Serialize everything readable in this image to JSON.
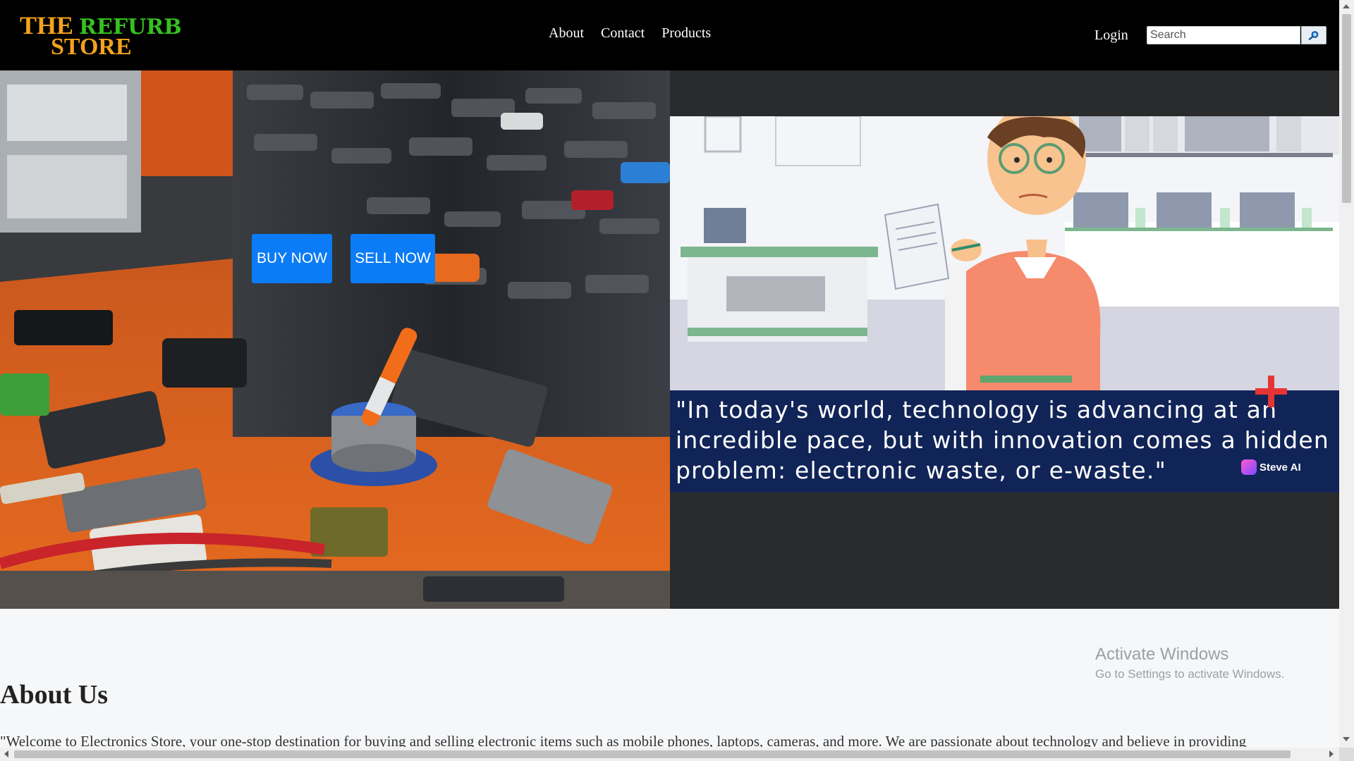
{
  "logo": {
    "line1_a": "THE",
    "line1_b": "REFURB",
    "line2": "STORE"
  },
  "nav": {
    "items": [
      "About",
      "Contact",
      "Products"
    ]
  },
  "header": {
    "login_label": "Login",
    "search_placeholder": "Search",
    "search_icon": "search-icon"
  },
  "hero": {
    "buy_label": "BUY NOW",
    "sell_label": "SELL NOW"
  },
  "video": {
    "caption": "\"In today's world, technology is advancing at an incredible pace, but with innovation comes a hidden problem: electronic waste, or e-waste.\"",
    "watermark": "Steve AI"
  },
  "watermark_os": {
    "title": "Activate Windows",
    "subtitle": "Go to Settings to activate Windows."
  },
  "about": {
    "title": "About Us",
    "text": "\"Welcome to Electronics Store, your one-stop destination for buying and selling electronic items such as mobile phones, laptops, cameras, and more. We are passionate about technology and believe in providing"
  },
  "colors": {
    "header_bg": "#000000",
    "logo_orange": "#f2a21e",
    "logo_green": "#35c11e",
    "button_blue": "#0b7cf5",
    "caption_band": "#112457",
    "page_bg": "#f6f7f9"
  }
}
